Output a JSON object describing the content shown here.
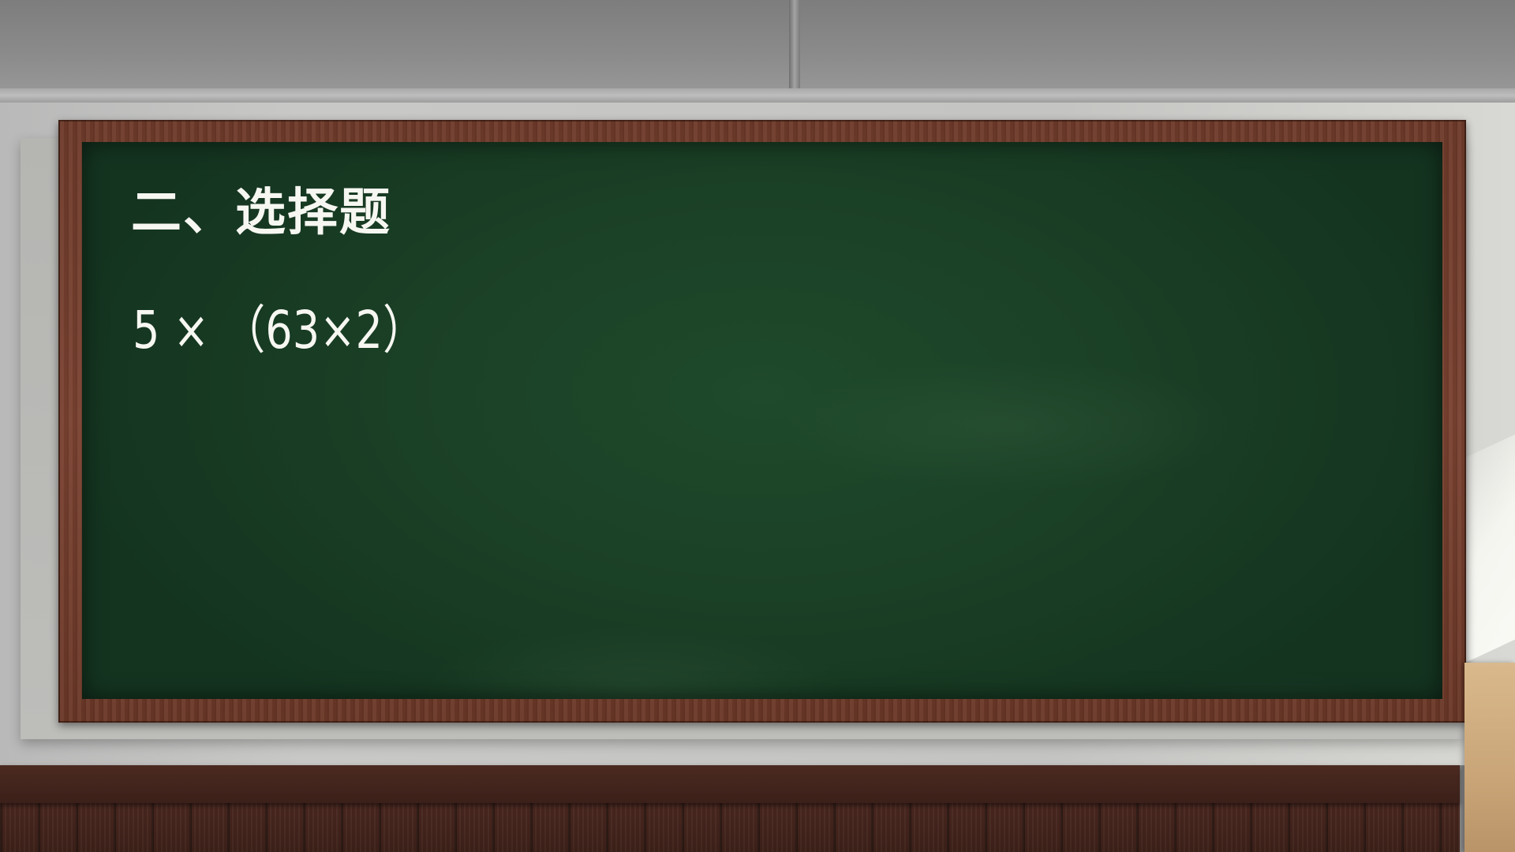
{
  "board": {
    "title": "二、选择题",
    "expression": "5 × （63×2）"
  },
  "colors": {
    "chalkboard": "#1d4428",
    "frame": "#74402f",
    "chalk": "#f7f7f2",
    "wall": "#c6c6c4",
    "wainscot": "#45251d"
  }
}
